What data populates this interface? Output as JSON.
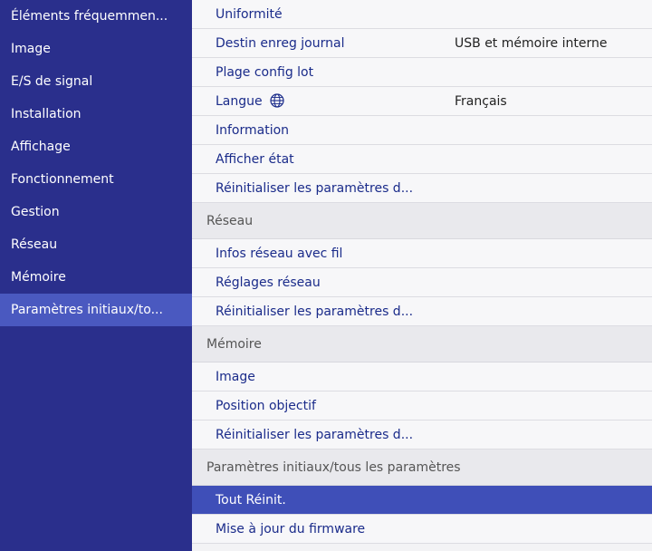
{
  "sidebar": {
    "items": [
      {
        "label": "Éléments fréquemmen..."
      },
      {
        "label": "Image"
      },
      {
        "label": "E/S de signal"
      },
      {
        "label": "Installation"
      },
      {
        "label": "Affichage"
      },
      {
        "label": "Fonctionnement"
      },
      {
        "label": "Gestion"
      },
      {
        "label": "Réseau"
      },
      {
        "label": "Mémoire"
      },
      {
        "label": "Paramètres initiaux/to..."
      }
    ],
    "selected_index": 9
  },
  "main": {
    "rows": [
      {
        "label": "Uniformité"
      },
      {
        "label": "Destin enreg journal",
        "value": "USB et mémoire interne"
      },
      {
        "label": "Plage config lot"
      },
      {
        "label": "Langue",
        "icon": "globe-icon",
        "value": "Français"
      },
      {
        "label": "Information"
      },
      {
        "label": "Afficher état"
      },
      {
        "label": "Réinitialiser les paramètres d..."
      }
    ],
    "sections": [
      {
        "title": "Réseau",
        "rows": [
          {
            "label": "Infos réseau avec fil"
          },
          {
            "label": "Réglages réseau"
          },
          {
            "label": "Réinitialiser les paramètres d..."
          }
        ]
      },
      {
        "title": "Mémoire",
        "rows": [
          {
            "label": "Image"
          },
          {
            "label": "Position objectif"
          },
          {
            "label": "Réinitialiser les paramètres d..."
          }
        ]
      },
      {
        "title": "Paramètres initiaux/tous les paramètres",
        "rows": [
          {
            "label": "Tout Réinit.",
            "highlighted": true
          },
          {
            "label": "Mise à jour du firmware"
          }
        ]
      }
    ]
  },
  "colors": {
    "sidebar_bg": "#2a2f8c",
    "sidebar_selected": "#4a59c0",
    "highlight": "#3f4fb8",
    "item_text": "#1a2b8a"
  }
}
